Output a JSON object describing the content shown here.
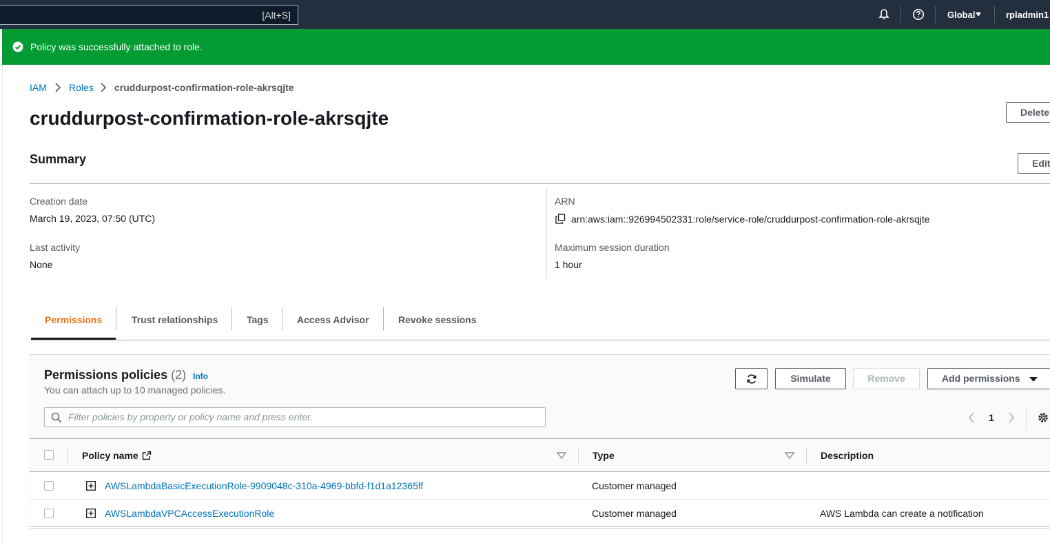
{
  "topnav": {
    "search_shortcut": "[Alt+S]",
    "region": "Global",
    "user": "rpladmin1 @"
  },
  "flash": {
    "message": "Policy was successfully attached to role.",
    "color": "#039b32"
  },
  "breadcrumb": {
    "items": [
      "IAM",
      "Roles",
      "cruddurpost-confirmation-role-akrsqjte"
    ]
  },
  "page": {
    "title": "cruddurpost-confirmation-role-akrsqjte",
    "delete_label": "Delete"
  },
  "summary": {
    "title": "Summary",
    "edit_label": "Edit",
    "creation_date_label": "Creation date",
    "creation_date": "March 19, 2023, 07:50 (UTC)",
    "last_activity_label": "Last activity",
    "last_activity": "None",
    "arn_label": "ARN",
    "arn": "arn:aws:iam::926994502331:role/service-role/cruddurpost-confirmation-role-akrsqjte",
    "max_session_label": "Maximum session duration",
    "max_session": "1 hour"
  },
  "tabs": [
    {
      "label": "Permissions",
      "active": true
    },
    {
      "label": "Trust relationships",
      "active": false
    },
    {
      "label": "Tags",
      "active": false
    },
    {
      "label": "Access Advisor",
      "active": false
    },
    {
      "label": "Revoke sessions",
      "active": false
    }
  ],
  "permissions": {
    "title": "Permissions policies",
    "count": "(2)",
    "info": "Info",
    "subtitle": "You can attach up to 10 managed policies.",
    "simulate_label": "Simulate",
    "remove_label": "Remove",
    "add_label": "Add permissions",
    "filter_placeholder": "Filter policies by property or policy name and press enter.",
    "page": "1",
    "columns": [
      "Policy name",
      "Type",
      "Description"
    ],
    "rows": [
      {
        "name": "AWSLambdaBasicExecutionRole-9909048c-310a-4969-bbfd-f1d1a12365ff",
        "type": "Customer managed",
        "description": ""
      },
      {
        "name": "AWSLambdaVPCAccessExecutionRole",
        "type": "Customer managed",
        "description": "AWS Lambda can create a notification"
      }
    ]
  },
  "colors": {
    "topbar": "#232f3e",
    "link": "#0073bb",
    "active_tab": "#ec7211"
  }
}
